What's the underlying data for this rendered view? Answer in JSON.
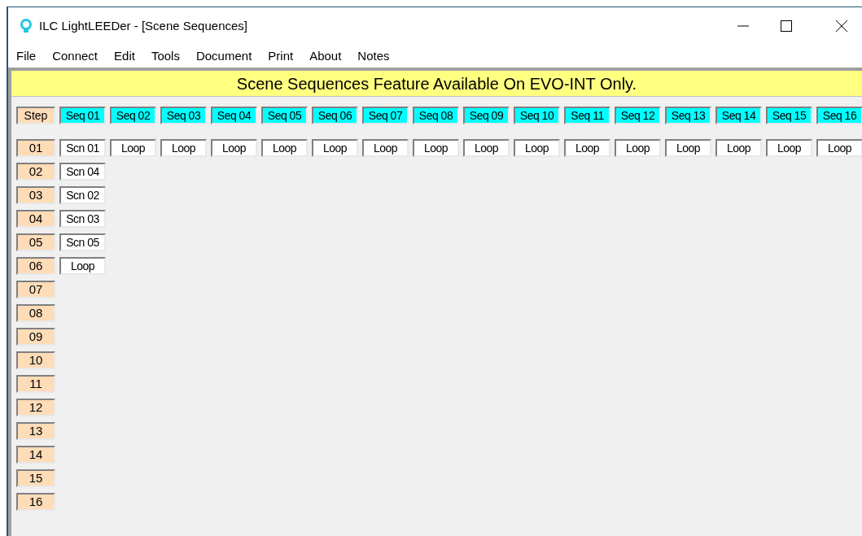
{
  "window": {
    "title": "ILC LightLEEDer - [Scene Sequences]"
  },
  "menu": [
    "File",
    "Connect",
    "Edit",
    "Tools",
    "Document",
    "Print",
    "About",
    "Notes"
  ],
  "banner": "Scene Sequences Feature Available On EVO-INT Only.",
  "step_header": "Step",
  "steps": [
    "01",
    "02",
    "03",
    "04",
    "05",
    "06",
    "07",
    "08",
    "09",
    "10",
    "11",
    "12",
    "13",
    "14",
    "15",
    "16"
  ],
  "sequences": [
    {
      "label": "Seq 01",
      "entries": [
        "Scn 01",
        "Scn 04",
        "Scn 02",
        "Scn 03",
        "Scn 05",
        "Loop"
      ]
    },
    {
      "label": "Seq 02",
      "entries": [
        "Loop"
      ]
    },
    {
      "label": "Seq 03",
      "entries": [
        "Loop"
      ]
    },
    {
      "label": "Seq 04",
      "entries": [
        "Loop"
      ]
    },
    {
      "label": "Seq 05",
      "entries": [
        "Loop"
      ]
    },
    {
      "label": "Seq 06",
      "entries": [
        "Loop"
      ]
    },
    {
      "label": "Seq 07",
      "entries": [
        "Loop"
      ]
    },
    {
      "label": "Seq 08",
      "entries": [
        "Loop"
      ]
    },
    {
      "label": "Seq 09",
      "entries": [
        "Loop"
      ]
    },
    {
      "label": "Seq 10",
      "entries": [
        "Loop"
      ]
    },
    {
      "label": "Seq 11",
      "entries": [
        "Loop"
      ]
    },
    {
      "label": "Seq 12",
      "entries": [
        "Loop"
      ]
    },
    {
      "label": "Seq 13",
      "entries": [
        "Loop"
      ]
    },
    {
      "label": "Seq 14",
      "entries": [
        "Loop"
      ]
    },
    {
      "label": "Seq 15",
      "entries": [
        "Loop"
      ]
    },
    {
      "label": "Seq 16",
      "entries": [
        "Loop"
      ]
    }
  ]
}
